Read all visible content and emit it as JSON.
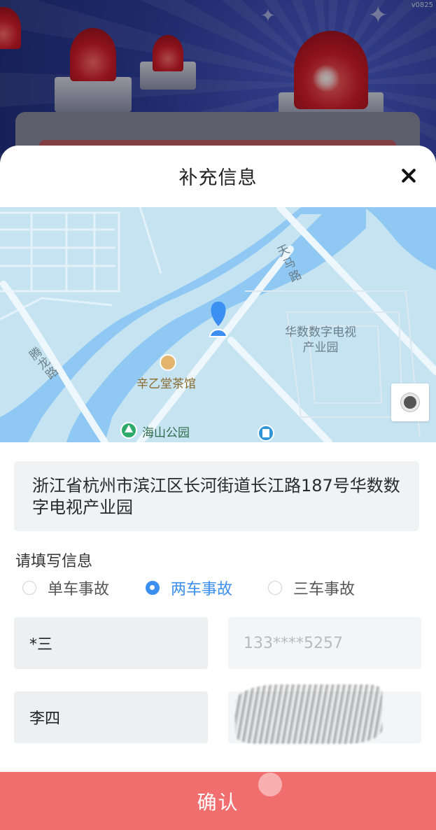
{
  "app": {
    "version": "v0825"
  },
  "modal": {
    "title": "补充信息"
  },
  "map": {
    "labels": {
      "road_tianma": "天马路",
      "road_tenglong": "腾龙路",
      "area": "华数数字电视产业园",
      "teahouse": "辛乙堂茶馆",
      "park": "海山公园"
    },
    "icons": {
      "pin": "location-pin-icon",
      "locate": "locate-icon"
    }
  },
  "address": "浙江省杭州市滨江区长河街道长江路187号华数数字电视产业园",
  "form": {
    "section_label": "请填写信息",
    "options": [
      {
        "label": "单车事故",
        "checked": false
      },
      {
        "label": "两车事故",
        "checked": true
      },
      {
        "label": "三车事故",
        "checked": false
      }
    ],
    "parties": [
      {
        "name": "*三",
        "phone_placeholder": "133****5257"
      },
      {
        "name": "李四",
        "phone_placeholder": ""
      }
    ]
  },
  "confirm_label": "确认",
  "colors": {
    "accent": "#3b8ff0",
    "confirm": "#f06e6e",
    "map_water": "#8ec8f3"
  }
}
